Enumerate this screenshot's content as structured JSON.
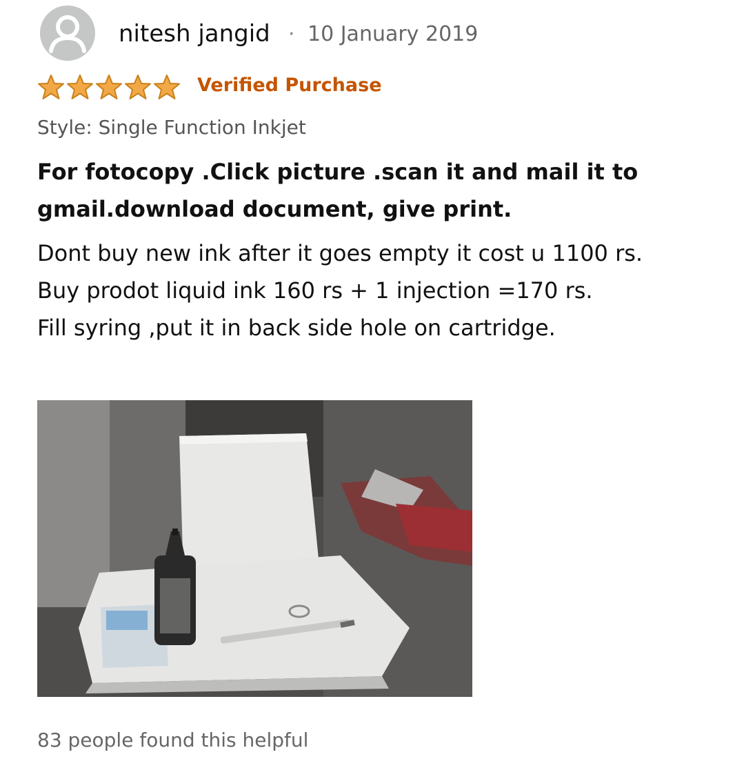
{
  "review": {
    "reviewer": {
      "name": "nitesh jangid",
      "avatar_icon": "user-avatar-icon"
    },
    "date": "10 January 2019",
    "separator": "·",
    "rating": {
      "stars": 5,
      "max": 5,
      "star_color": "#f3a847",
      "star_outline": "#c8811a"
    },
    "verified_label": "Verified Purchase",
    "style": "Style: Single Function Inkjet",
    "title": "For fotocopy .Click picture .scan it and mail it to gmail.download document, give print.",
    "body": [
      "Dont buy new ink after it goes empty it cost u 1100 rs.",
      "Buy prodot liquid ink 160 rs + 1 injection =170 rs.",
      "Fill syring ,put it in back side hole on cartridge."
    ],
    "helpful": "83 people found this helpful"
  },
  "colors": {
    "verified": "#c45500",
    "meta_text": "#666666"
  }
}
